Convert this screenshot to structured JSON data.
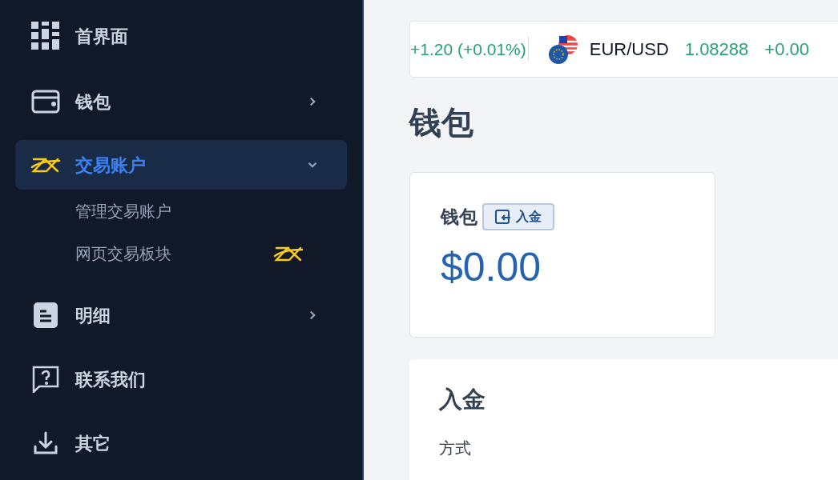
{
  "sidebar": {
    "items": [
      {
        "label": "首界面",
        "kind": "grid",
        "selected": false
      },
      {
        "label": "钱包",
        "kind": "wallet",
        "selected": false,
        "expanded": false
      },
      {
        "label": "交易账户",
        "kind": "logo",
        "selected": true,
        "expanded": true,
        "children": [
          {
            "label": "管理交易账户",
            "kind": "plain"
          },
          {
            "label": "网页交易板块",
            "kind": "logo"
          }
        ]
      },
      {
        "label": "明细",
        "kind": "document",
        "selected": false,
        "expanded": false
      },
      {
        "label": "联系我们",
        "kind": "question",
        "selected": false
      },
      {
        "label": "其它",
        "kind": "download",
        "selected": false
      }
    ]
  },
  "ticker": [
    {
      "kind": "change",
      "text": "+1.20 (+0.01%)"
    },
    {
      "kind": "pair",
      "symbol": "EUR/USD",
      "price": "1.08288",
      "change": "+0.00"
    }
  ],
  "page_title": "钱包",
  "wallet_card": {
    "title": "钱包",
    "button": "入金",
    "amount": "$0.00"
  },
  "deposit_card": {
    "title": "入金",
    "method_label": "方式"
  }
}
